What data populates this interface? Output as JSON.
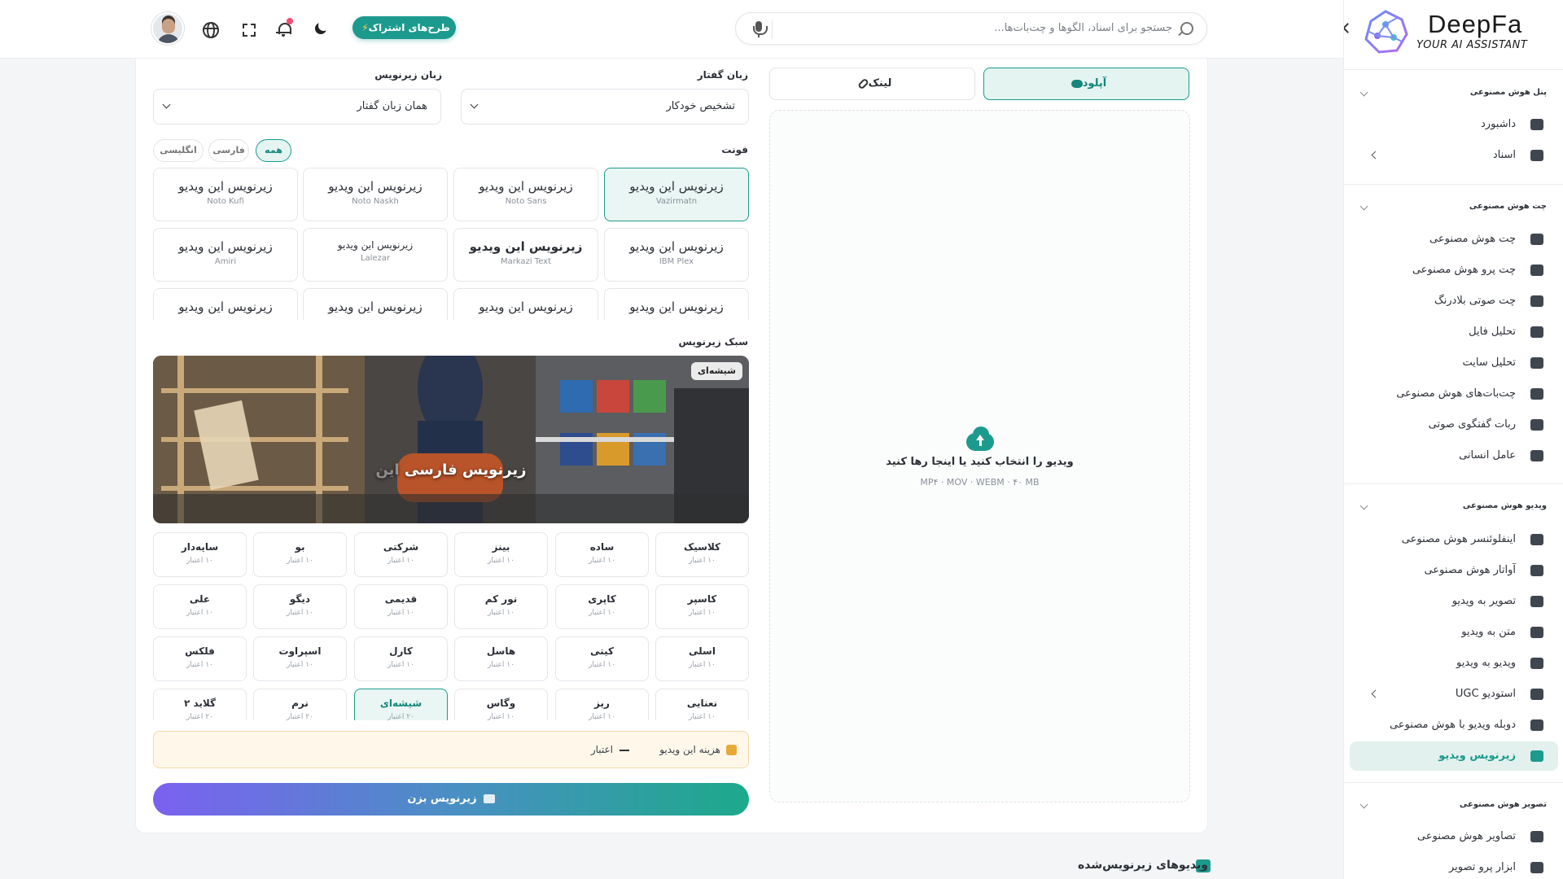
{
  "brand": {
    "name": "DeepFa",
    "tagline": "YOUR AI ASSISTANT"
  },
  "topbar": {
    "search_placeholder": "جستجو برای اسناد، الگوها و چت‌بات‌ها...",
    "subscribe_label": "طرح‌های اشتراک"
  },
  "sidebar": {
    "sections": [
      {
        "title": "پنل هوش مصنوعی",
        "items": [
          {
            "label": "داشبورد",
            "icon": "dashboard-icon"
          },
          {
            "label": "اسناد",
            "icon": "folder-icon",
            "has_children": true
          }
        ]
      },
      {
        "title": "چت هوش مصنوعی",
        "items": [
          {
            "label": "چت هوش مصنوعی",
            "icon": "chat-icon"
          },
          {
            "label": "چت پرو هوش مصنوعی",
            "icon": "chat-pro-icon"
          },
          {
            "label": "چت صوتی بلادرنگ",
            "icon": "voice-wave-icon"
          },
          {
            "label": "تحلیل فایل",
            "icon": "file-icon"
          },
          {
            "label": "تحلیل سایت",
            "icon": "globe-icon"
          },
          {
            "label": "چت‌بات‌های هوش مصنوعی",
            "icon": "bot-icon"
          },
          {
            "label": "ربات گفتگوی صوتی",
            "icon": "voice-bot-icon"
          },
          {
            "label": "عامل انسانی",
            "icon": "headset-icon"
          }
        ]
      },
      {
        "title": "ویدیو هوش مصنوعی",
        "items": [
          {
            "label": "اینفلوئنسر هوش مصنوعی",
            "icon": "video-icon"
          },
          {
            "label": "آواتار هوش مصنوعی",
            "icon": "avatar-icon"
          },
          {
            "label": "تصویر به ویدیو",
            "icon": "camera-icon"
          },
          {
            "label": "متن به ویدیو",
            "icon": "camera-plus-icon"
          },
          {
            "label": "ویدیو به ویدیو",
            "icon": "video-swap-icon"
          },
          {
            "label": "استودیو UGC",
            "icon": "clapper-icon",
            "has_children": true
          },
          {
            "label": "دوبله ویدیو با هوش مصنوعی",
            "icon": "dub-icon"
          },
          {
            "label": "زیرنویس ویدیو",
            "icon": "cc-icon",
            "active": true
          }
        ]
      },
      {
        "title": "تصویر هوش مصنوعی",
        "items": [
          {
            "label": "تصاویر هوش مصنوعی",
            "icon": "image-scan-icon"
          },
          {
            "label": "ابزار پرو تصویر",
            "icon": "palette-icon"
          }
        ]
      }
    ]
  },
  "upload": {
    "tab_upload": "آپلود",
    "tab_link": "لینک",
    "drop_title": "ویدیو را انتخاب کنید یا اینجا رها کنید",
    "drop_formats": "MP۴ · MOV · WEBM · ۴۰ MB"
  },
  "settings": {
    "speech_lang_label": "زبان گفتار",
    "speech_lang_value": "تشخیص خودکار",
    "sub_lang_label": "زبان زیرنویس",
    "sub_lang_value": "همان زبان گفتار",
    "font_label": "فونت",
    "font_filters": [
      {
        "label": "همه",
        "selected": true
      },
      {
        "label": "فارسی"
      },
      {
        "label": "انگلیسی"
      }
    ],
    "font_sample": "زیرنویس این ویدیو",
    "fonts": [
      {
        "name": "Vazirmatn",
        "selected": true
      },
      {
        "name": "Noto Sans"
      },
      {
        "name": "Noto Naskh"
      },
      {
        "name": "Noto Kufi"
      },
      {
        "name": "IBM Plex"
      },
      {
        "name": "Markazi Text"
      },
      {
        "name": "Lalezar"
      },
      {
        "name": "Amiri"
      },
      {
        "name": ""
      },
      {
        "name": ""
      },
      {
        "name": ""
      },
      {
        "name": ""
      }
    ],
    "style_label": "سبک زیرنویس",
    "preview_badge": "شیشه‌ای",
    "preview_caption_main": "زیرنویس فارسی",
    "preview_caption_ghost": "این",
    "styles": [
      {
        "name": "کلاسیک",
        "cost": "۱۰ اعتبار"
      },
      {
        "name": "ساده",
        "cost": "۱۰ اعتبار"
      },
      {
        "name": "بینز",
        "cost": "۱۰ اعتبار"
      },
      {
        "name": "شرکتی",
        "cost": "۱۰ اعتبار"
      },
      {
        "name": "بو",
        "cost": "۱۰ اعتبار"
      },
      {
        "name": "سایه‌دار",
        "cost": "۱۰ اعتبار"
      },
      {
        "name": "کاسپر",
        "cost": "۱۰ اعتبار"
      },
      {
        "name": "کاپری",
        "cost": "۱۰ اعتبار"
      },
      {
        "name": "نور کم",
        "cost": "۱۰ اعتبار"
      },
      {
        "name": "قدیمی",
        "cost": "۱۰ اعتبار"
      },
      {
        "name": "دیگو",
        "cost": "۱۰ اعتبار"
      },
      {
        "name": "علی",
        "cost": "۱۰ اعتبار"
      },
      {
        "name": "اسلی",
        "cost": "۱۰ اعتبار"
      },
      {
        "name": "کیتی",
        "cost": "۱۰ اعتبار"
      },
      {
        "name": "هاسل",
        "cost": "۱۰ اعتبار"
      },
      {
        "name": "کارل",
        "cost": "۱۰ اعتبار"
      },
      {
        "name": "اسپراوت",
        "cost": "۱۰ اعتبار"
      },
      {
        "name": "فلکس",
        "cost": "۱۰ اعتبار"
      },
      {
        "name": "نعنایی",
        "cost": "۱۰ اعتبار"
      },
      {
        "name": "ریز",
        "cost": "۱۰ اعتبار"
      },
      {
        "name": "وگاس",
        "cost": "۱۰ اعتبار"
      },
      {
        "name": "شیشه‌ای",
        "cost": "۲۰ اعتبار",
        "selected": true
      },
      {
        "name": "نرم",
        "cost": "۲۰ اعتبار"
      },
      {
        "name": "گلاید ۲",
        "cost": "۲۰ اعتبار"
      }
    ],
    "cost_label": "هزینه این ویدیو",
    "cost_unit": "اعتبار",
    "submit_label": "زیرنویس بزن"
  },
  "history_title": "ویدیوهای زیرنویس‌شده",
  "colors": {
    "accent": "#1d9a8e",
    "warning_bg": "#fff8ea"
  }
}
